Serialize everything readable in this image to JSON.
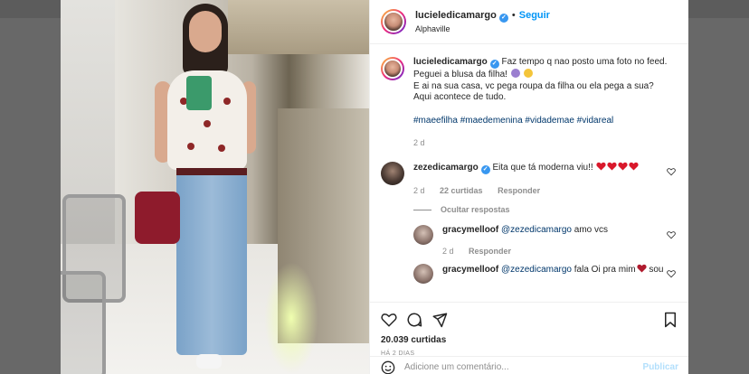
{
  "post": {
    "username": "lucieledicamargo",
    "follow_label": "Seguir",
    "location": "Alphaville",
    "caption": {
      "username": "lucieledicamargo",
      "line1": "Faz tempo q nao posto uma foto no feed.",
      "line2": "Peguei a blusa da filha!",
      "line3": "E ai na sua casa, vc pega roupa da filha ou ela pega a sua?",
      "line4": "Aqui acontece de tudo.",
      "hashtags": "#maeefilha #maedemenina #vidademae #vidareal",
      "time": "2 d"
    },
    "likes": "20.039 curtidas",
    "posted_ago": "HÁ 2 DIAS",
    "add_comment_placeholder": "Adicione um comentário...",
    "publish_label": "Publicar"
  },
  "comments": [
    {
      "username": "zezedicamargo",
      "text": "Eita que tá moderna viu!!",
      "time": "2 d",
      "likes": "22 curtidas",
      "reply_label": "Responder",
      "hide_replies_label": "Ocultar respostas"
    }
  ],
  "replies": [
    {
      "username": "gracymelloof",
      "mention": "@zezedicamargo",
      "text": "amo vcs",
      "time": "2 d",
      "reply_label": "Responder"
    },
    {
      "username": "gracymelloof",
      "mention": "@zezedicamargo",
      "text": "fala Oi pra mim",
      "text_tail": "sou"
    }
  ],
  "colors": {
    "accent": "#0095f6",
    "hashtag": "#00376b",
    "muted": "#8e8e8e",
    "heart": "#ed4956"
  },
  "icons": [
    "verified-icon",
    "heart-icon",
    "comment-icon",
    "share-icon",
    "bookmark-icon",
    "emoji-icon"
  ]
}
